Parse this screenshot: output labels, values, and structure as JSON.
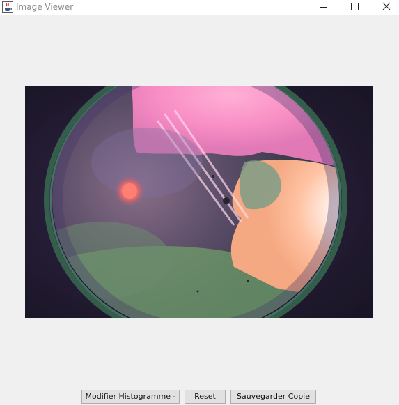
{
  "window": {
    "title": "Image Viewer",
    "app_icon": "java-cup-icon",
    "controls": [
      "minimize-icon",
      "maximize-icon",
      "close-icon"
    ]
  },
  "image": {
    "description_icon": "fisheye-photo"
  },
  "buttons": {
    "histogram_label": "Modifier Histogramme -",
    "reset_label": "Reset",
    "save_copy_label": "Sauvegarder Copie"
  },
  "colors": {
    "window_background": "#f0f0f0",
    "titlebar_background": "#ffffff",
    "button_background": "#e1e1e1",
    "button_border": "#adadad"
  }
}
